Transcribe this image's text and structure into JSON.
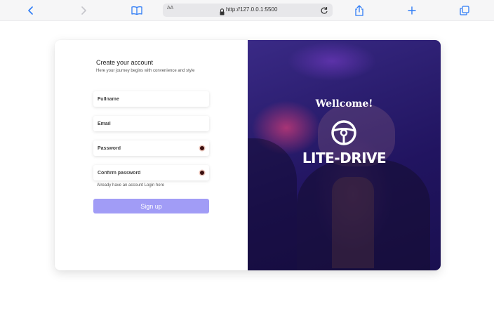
{
  "browser": {
    "aa_label": "AA",
    "url": "http://127.0.0.1:5500"
  },
  "form": {
    "title": "Create your account",
    "subtitle": "Here your journey begins with convenience and style",
    "fullname_placeholder": "Fullname",
    "email_placeholder": "Email",
    "password_placeholder": "Password",
    "confirm_placeholder": "Confirm password",
    "login_note": "Already have an account Login here",
    "signup_label": "Sign up"
  },
  "hero": {
    "welcome": "Wellcome!",
    "brand": "LITE-DRIVE",
    "icon": "steering-wheel-icon"
  },
  "colors": {
    "signup_button": "#a19cf6",
    "hero_base": "#2a1d6e",
    "toolbar_icon": "#2f7cf6"
  }
}
